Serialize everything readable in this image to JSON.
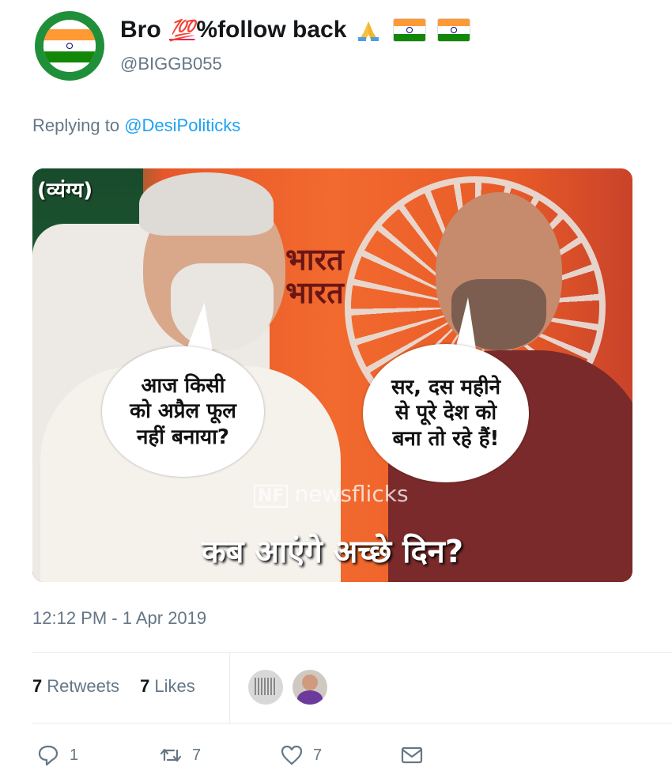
{
  "tweet": {
    "display_name": "Bro",
    "display_name_badge": "💯",
    "display_name_suffix": "%follow back",
    "handle": "@BIGGB055",
    "replying_prefix": "Replying to",
    "replying_to": "@DesiPoliticks",
    "timestamp": "12:12 PM - 1 Apr 2019"
  },
  "media": {
    "tag": "(व्यंग्य)",
    "sign": "भारत\nभारत",
    "bubble_left": "आज किसी\nको अप्रैल फूल\nनहीं बनाया?",
    "bubble_right": "सर, दस महीने\nसे पूरे देश को\nबना तो रहे हैं!",
    "watermark_logo": "NF",
    "watermark": "newsflicks",
    "caption": "कब आएंगे अच्छे दिन?"
  },
  "stats": {
    "retweets_count": "7",
    "retweets_label": "Retweets",
    "likes_count": "7",
    "likes_label": "Likes"
  },
  "actions": {
    "reply_count": "1",
    "retweet_count": "7",
    "like_count": "7"
  },
  "colors": {
    "link": "#1da1f2",
    "muted": "#657786",
    "text": "#14171a"
  }
}
